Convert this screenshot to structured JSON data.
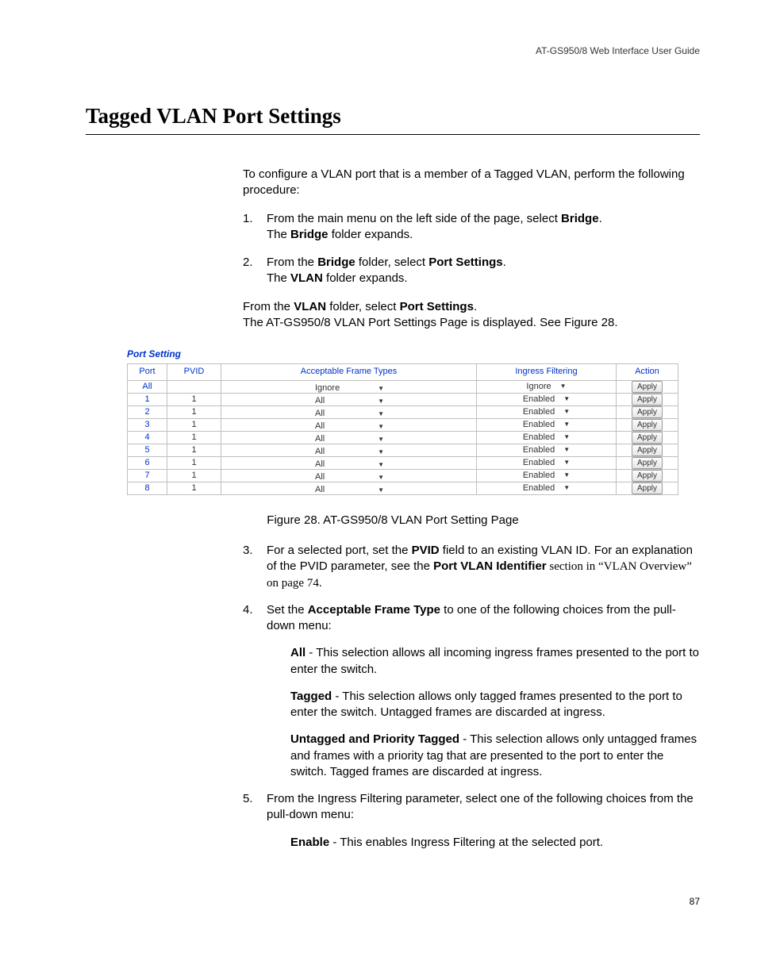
{
  "header": {
    "right": "AT-GS950/8  Web Interface User Guide"
  },
  "title": "Tagged VLAN Port Settings",
  "intro": "To configure a VLAN port that is a member of a Tagged VLAN, perform the following procedure:",
  "steps_a": [
    {
      "num": "1.",
      "line1_a": "From the main menu on the left side of the page, select ",
      "line1_b": "Bridge",
      "line1_c": ".",
      "line2_a": "The ",
      "line2_b": "Bridge",
      "line2_c": " folder expands."
    },
    {
      "num": "2.",
      "line1_a": "From the ",
      "line1_b": "Bridge",
      "line1_c": " folder, select ",
      "line1_d": "Port Settings",
      "line1_e": ".",
      "line2_a": "The ",
      "line2_b": "VLAN",
      "line2_c": " folder expands."
    }
  ],
  "after_steps_a": {
    "line1_a": "From the ",
    "line1_b": "VLAN",
    "line1_c": " folder, select ",
    "line1_d": "Port Settings",
    "line1_e": ".",
    "line2": "The AT-GS950/8 VLAN Port Settings Page is displayed. See Figure 28."
  },
  "figure": {
    "heading": "Port Setting",
    "columns": {
      "port": "Port",
      "pvid": "PVID",
      "frame": "Acceptable Frame Types",
      "filter": "Ingress Filtering",
      "action": "Action"
    },
    "rows": [
      {
        "port": "All",
        "pvid": "",
        "frame": "Ignore",
        "filter": "Ignore",
        "apply": "Apply"
      },
      {
        "port": "1",
        "pvid": "1",
        "frame": "All",
        "filter": "Enabled",
        "apply": "Apply"
      },
      {
        "port": "2",
        "pvid": "1",
        "frame": "All",
        "filter": "Enabled",
        "apply": "Apply"
      },
      {
        "port": "3",
        "pvid": "1",
        "frame": "All",
        "filter": "Enabled",
        "apply": "Apply"
      },
      {
        "port": "4",
        "pvid": "1",
        "frame": "All",
        "filter": "Enabled",
        "apply": "Apply"
      },
      {
        "port": "5",
        "pvid": "1",
        "frame": "All",
        "filter": "Enabled",
        "apply": "Apply"
      },
      {
        "port": "6",
        "pvid": "1",
        "frame": "All",
        "filter": "Enabled",
        "apply": "Apply"
      },
      {
        "port": "7",
        "pvid": "1",
        "frame": "All",
        "filter": "Enabled",
        "apply": "Apply"
      },
      {
        "port": "8",
        "pvid": "1",
        "frame": "All",
        "filter": "Enabled",
        "apply": "Apply"
      }
    ],
    "caption": "Figure 28. AT-GS950/8 VLAN Port Setting Page"
  },
  "steps_b": [
    {
      "num": "3.",
      "t1": "For a selected port, set the ",
      "b1": "PVID",
      "t2": " field to an existing VLAN ID. For an explanation of the PVID parameter, see the ",
      "b2": "Port VLAN Identifier",
      "t3": " section in “VLAN Overview” on page 74."
    },
    {
      "num": "4.",
      "t1": "Set the ",
      "b1": "Acceptable Frame Type",
      "t2": " to one of the following choices from the pull-down menu:",
      "subs": [
        {
          "b": "All",
          "t": " - This selection allows all incoming ingress frames presented to the port to enter the switch."
        },
        {
          "b": "Tagged",
          "t": " - This selection allows only tagged frames presented to the port to enter the switch. Untagged frames are discarded at ingress."
        },
        {
          "b": "Untagged and Priority Tagged",
          "t": " - This selection allows only untagged frames and frames with a priority tag that are presented to the port to enter the switch. Tagged frames are discarded at ingress."
        }
      ]
    },
    {
      "num": "5.",
      "t1": "From the Ingress Filtering parameter, select one of the following choices from the pull-down menu:",
      "subs": [
        {
          "b": "Enable",
          "t": " - This enables Ingress Filtering at the selected port."
        }
      ]
    }
  ],
  "page_number": "87"
}
